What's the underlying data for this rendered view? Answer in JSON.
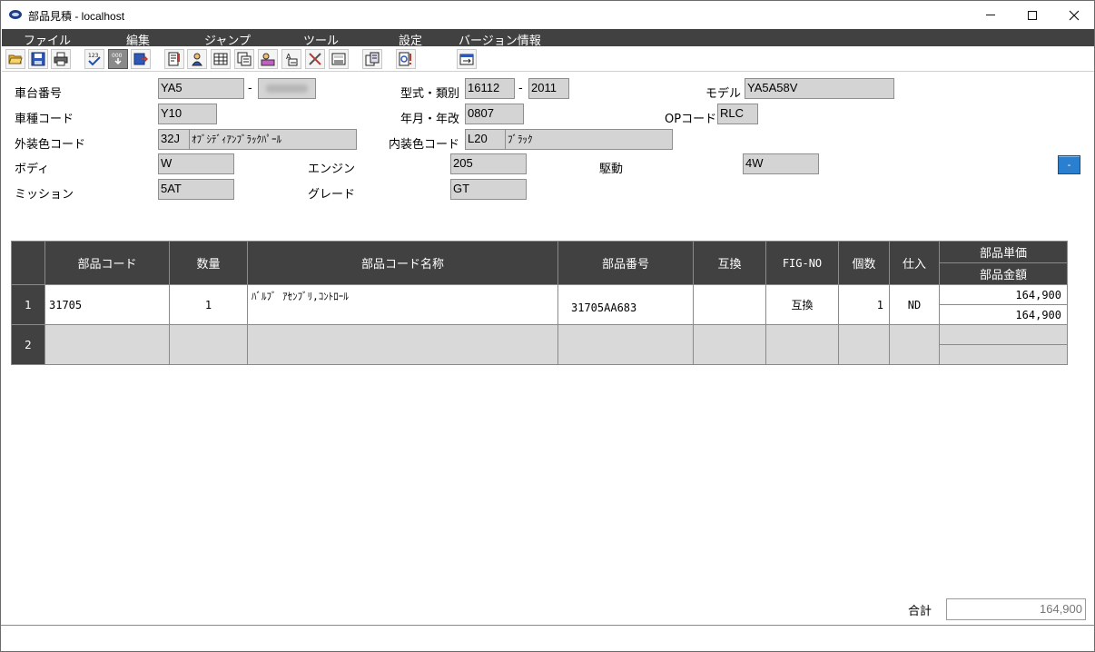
{
  "window": {
    "title": "部品見積 - localhost"
  },
  "menu": [
    "ファイル",
    "編集",
    "ジャンプ",
    "ツール",
    "設定",
    "バージョン情報"
  ],
  "toolbar": {
    "buttons": [
      "open-folder-icon",
      "save-icon",
      "print-icon",
      "check-numbers-icon",
      "renumber-icon",
      "export-icon",
      "edit-document-icon",
      "user-icon",
      "grid-icon",
      "copy-list-icon",
      "search-user-icon",
      "text-edit-icon",
      "tools-icon",
      "calculator-icon",
      "stack-documents-icon",
      "alert-document-icon",
      "window-switch-icon"
    ],
    "active": "renumber-icon"
  },
  "form": {
    "chassis_label": "車台番号",
    "chassis_value": "YA5",
    "chassis_serial": "",
    "type_label": "型式・類別",
    "type_value1": "16112",
    "type_value2": "2011",
    "model_label": "モデル",
    "model_value": "YA5A58V",
    "vehicle_code_label": "車種コード",
    "vehicle_code_value": "Y10",
    "date_label": "年月・年改",
    "date_value": "0807",
    "op_code_label": "OPコード",
    "op_code_value": "RLC",
    "ext_color_label": "外装色コード",
    "ext_color_code": "32J",
    "ext_color_name": "ｵﾌﾞｼﾃﾞｨｱﾝﾌﾞﾗｯｸﾊﾟｰﾙ",
    "int_color_label": "内装色コード",
    "int_color_code": "L20",
    "int_color_name": "ﾌﾞﾗｯｸ",
    "body_label": "ボディ",
    "body_value": "W",
    "engine_label": "エンジン",
    "engine_value": "205",
    "drive_label": "駆動",
    "drive_value": "4W",
    "mission_label": "ミッション",
    "mission_value": "5AT",
    "grade_label": "グレード",
    "grade_value": "GT",
    "collapse_label": "-"
  },
  "table": {
    "headers": {
      "part_code": "部品コード",
      "qty": "数量",
      "part_name": "部品コード名称",
      "part_number": "部品番号",
      "compat": "互換",
      "fig": "FIG-NO",
      "count": "個数",
      "supply": "仕入",
      "unit_price": "部品単価",
      "amount": "部品金額"
    },
    "rows": [
      {
        "no": "1",
        "part_code": "31705",
        "qty": "1",
        "part_name": "ﾊﾞﾙﾌﾞ ｱｾﾝﾌﾞﾘ,ｺﾝﾄﾛｰﾙ",
        "part_number": "31705AA683",
        "compat": "",
        "fig": "互換",
        "count": "1",
        "supply": "ND",
        "unit_price": "164,900",
        "amount": "164,900"
      },
      {
        "no": "2",
        "part_code": "",
        "qty": "",
        "part_name": "",
        "part_number": "",
        "compat": "",
        "fig": "",
        "count": "",
        "supply": "",
        "unit_price": "",
        "amount": ""
      }
    ]
  },
  "footer": {
    "total_label": "合計",
    "total_value": "164,900"
  },
  "colors": {
    "menu_bg": "#414141",
    "field_bg": "#d4d4d4",
    "empty_row_bg": "#d9d9d9",
    "accent_button": "#2a7fd0"
  }
}
